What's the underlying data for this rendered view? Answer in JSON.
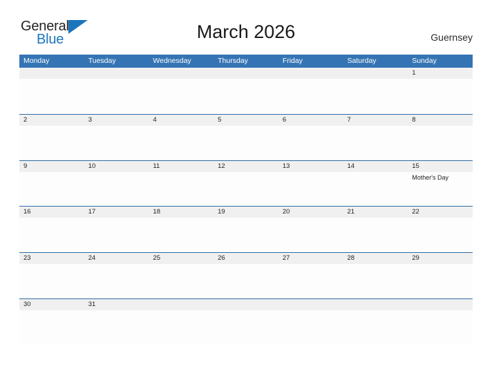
{
  "logo": {
    "word_top": "General",
    "word_bottom": "Blue",
    "flag_icon": "blue-triangle-flag-icon",
    "color_top": "#231f20",
    "color_bottom": "#1b75bb"
  },
  "header": {
    "title": "March 2026",
    "country": "Guernsey"
  },
  "theme": {
    "header_blue": "#3474b4",
    "row_rule_blue": "#2e6da4",
    "band_gray": "#f0f0f0",
    "cell_white": "#fdfdfd",
    "text_dark": "#1f1f1f"
  },
  "calendar": {
    "weekdays": [
      "Monday",
      "Tuesday",
      "Wednesday",
      "Thursday",
      "Friday",
      "Saturday",
      "Sunday"
    ],
    "weeks": [
      [
        {
          "day": "",
          "event": ""
        },
        {
          "day": "",
          "event": ""
        },
        {
          "day": "",
          "event": ""
        },
        {
          "day": "",
          "event": ""
        },
        {
          "day": "",
          "event": ""
        },
        {
          "day": "",
          "event": ""
        },
        {
          "day": "1",
          "event": ""
        }
      ],
      [
        {
          "day": "2",
          "event": ""
        },
        {
          "day": "3",
          "event": ""
        },
        {
          "day": "4",
          "event": ""
        },
        {
          "day": "5",
          "event": ""
        },
        {
          "day": "6",
          "event": ""
        },
        {
          "day": "7",
          "event": ""
        },
        {
          "day": "8",
          "event": ""
        }
      ],
      [
        {
          "day": "9",
          "event": ""
        },
        {
          "day": "10",
          "event": ""
        },
        {
          "day": "11",
          "event": ""
        },
        {
          "day": "12",
          "event": ""
        },
        {
          "day": "13",
          "event": ""
        },
        {
          "day": "14",
          "event": ""
        },
        {
          "day": "15",
          "event": "Mother's Day"
        }
      ],
      [
        {
          "day": "16",
          "event": ""
        },
        {
          "day": "17",
          "event": ""
        },
        {
          "day": "18",
          "event": ""
        },
        {
          "day": "19",
          "event": ""
        },
        {
          "day": "20",
          "event": ""
        },
        {
          "day": "21",
          "event": ""
        },
        {
          "day": "22",
          "event": ""
        }
      ],
      [
        {
          "day": "23",
          "event": ""
        },
        {
          "day": "24",
          "event": ""
        },
        {
          "day": "25",
          "event": ""
        },
        {
          "day": "26",
          "event": ""
        },
        {
          "day": "27",
          "event": ""
        },
        {
          "day": "28",
          "event": ""
        },
        {
          "day": "29",
          "event": ""
        }
      ],
      [
        {
          "day": "30",
          "event": ""
        },
        {
          "day": "31",
          "event": ""
        },
        {
          "day": "",
          "event": ""
        },
        {
          "day": "",
          "event": ""
        },
        {
          "day": "",
          "event": ""
        },
        {
          "day": "",
          "event": ""
        },
        {
          "day": "",
          "event": ""
        }
      ]
    ]
  }
}
